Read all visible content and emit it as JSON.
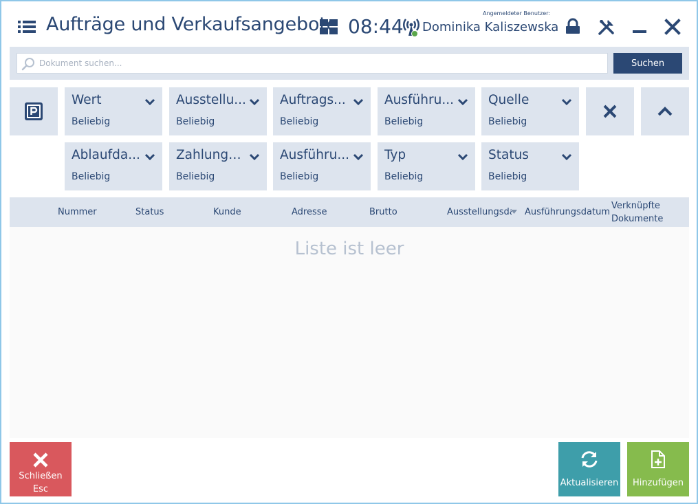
{
  "header": {
    "title": "Aufträge und Verkaufsangebote",
    "clock": "08:44",
    "user_caption": "Angemeldeter Benutzer:",
    "user_name": "Dominika Kaliszewska"
  },
  "search": {
    "placeholder": "Dokument suchen...",
    "value": "",
    "button_label": "Suchen"
  },
  "filters": [
    {
      "name": "Wert",
      "value": "Beliebig"
    },
    {
      "name": "Ausstellungsdatum",
      "value": "Beliebig"
    },
    {
      "name": "Auftragsstatus",
      "value": "Beliebig"
    },
    {
      "name": "Ausführungsdatum",
      "value": "Beliebig"
    },
    {
      "name": "Quelle",
      "value": "Beliebig"
    },
    {
      "name": "Ablaufdatum",
      "value": "Beliebig"
    },
    {
      "name": "Zahlungsstatus",
      "value": "Beliebig"
    },
    {
      "name": "Ausführungsstatus",
      "value": "Beliebig"
    },
    {
      "name": "Typ",
      "value": "Beliebig"
    },
    {
      "name": "Status",
      "value": "Beliebig"
    }
  ],
  "filter_display": [
    "Wert",
    "Ausstellu...",
    "Auftrags...",
    "Ausführu...",
    "Quelle",
    "Ablaufda...",
    "Zahlungs...",
    "Ausführu...",
    "Typ",
    "Status"
  ],
  "table": {
    "columns": [
      "Nummer",
      "Status",
      "Kunde",
      "Adresse",
      "Brutto",
      "Ausstellungsda",
      "Ausführungsdatum",
      "Verknüpfte",
      "Dokumente"
    ],
    "rows": [],
    "empty_message": "Liste ist leer"
  },
  "buttons": {
    "close_label": "Schließen",
    "close_shortcut": "Esc",
    "refresh_label": "Aktualisieren",
    "add_label": "Hinzufügen"
  },
  "icons": {
    "menu": "menu-icon",
    "tiles": "tiles-icon",
    "connection": "connection-status-icon",
    "lock": "lock-icon",
    "tools": "tools-icon",
    "minimize": "minimize-icon",
    "close": "close-icon",
    "parking": "parking-icon",
    "clear_filters": "clear-filters-icon",
    "collapse": "chevron-up-icon",
    "refresh": "refresh-icon",
    "add_document": "add-document-icon"
  },
  "colors": {
    "primary": "#2b4874",
    "panel": "#dde4ee",
    "close_button": "#d9585d",
    "refresh_button": "#3e9eaa",
    "add_button": "#86bb4d",
    "window_border": "#8fc7e8"
  }
}
